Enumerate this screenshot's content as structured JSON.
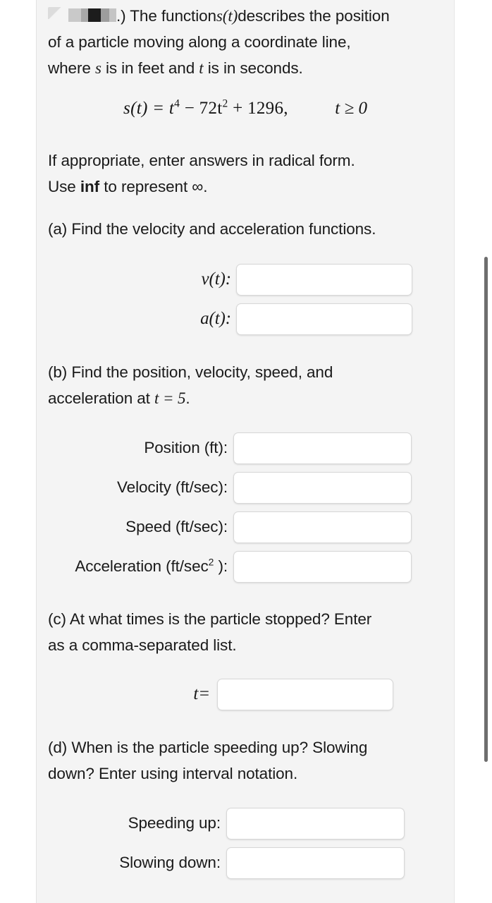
{
  "page": {
    "background_color": "#ffffff",
    "panel_color": "#f4f4f4"
  },
  "problem": {
    "redacted_prefix": "",
    "intro_after_redaction": ".) The function ",
    "intro_line1_a": " describes the position",
    "intro_line2": "of a particle moving along a coordinate line,",
    "intro_line3_a": "where ",
    "intro_line3_b": " is in feet and ",
    "intro_line3_c": " is in seconds.",
    "var_s": "s",
    "var_t": "t",
    "func_st": "s(t)",
    "equation": {
      "lhs": "s(t) = t",
      "exp1": "4",
      "mid": " − 72t",
      "exp2": "2",
      "rhs": " + 1296,",
      "condition": "t ≥ 0"
    },
    "instruction_line1": "If appropriate, enter answers in radical form.",
    "instruction_line2_a": "Use ",
    "instruction_line2_bold": "inf",
    "instruction_line2_b": " to represent ∞."
  },
  "part_a": {
    "prompt": "(a) Find the velocity and acceleration functions.",
    "rows": [
      {
        "label": "v(t):",
        "value": "",
        "placeholder": ""
      },
      {
        "label": "a(t):",
        "value": "",
        "placeholder": ""
      }
    ]
  },
  "part_b": {
    "prompt_line1": "(b) Find the position, velocity, speed, and",
    "prompt_line2_a": "acceleration at ",
    "prompt_line2_math": "t = 5",
    "prompt_line2_b": ".",
    "rows": [
      {
        "label": "Position (ft):",
        "value": "",
        "placeholder": ""
      },
      {
        "label": "Velocity (ft/sec):",
        "value": "",
        "placeholder": ""
      },
      {
        "label": "Speed (ft/sec):",
        "value": "",
        "placeholder": ""
      },
      {
        "label_base": "Acceleration (ft/sec",
        "label_sup": "2",
        "label_tail": " ):",
        "value": "",
        "placeholder": ""
      }
    ]
  },
  "part_c": {
    "prompt_line1": "(c) At what times is the particle stopped? Enter",
    "prompt_line2": "as a comma-separated list.",
    "rows": [
      {
        "label": "t=",
        "value": "",
        "placeholder": ""
      }
    ]
  },
  "part_d": {
    "prompt_line1": "(d) When is the particle speeding up? Slowing",
    "prompt_line2": "down? Enter using interval notation.",
    "rows": [
      {
        "label": "Speeding up:",
        "value": "",
        "placeholder": ""
      },
      {
        "label": "Slowing down:",
        "value": "",
        "placeholder": ""
      }
    ]
  },
  "scrollbar": {
    "thumb_color": "#6e6e6e"
  }
}
